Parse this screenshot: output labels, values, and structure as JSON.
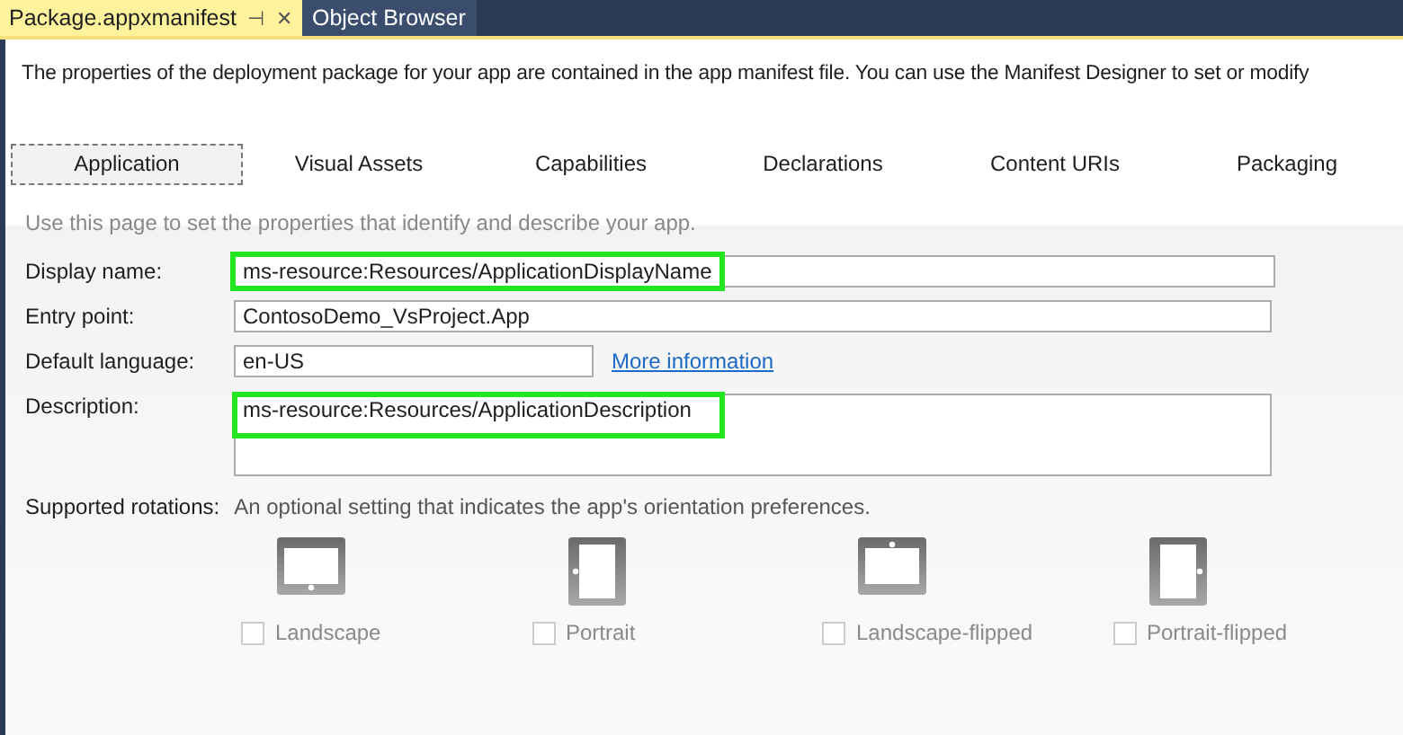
{
  "document_tabs": [
    {
      "label": "Package.appxmanifest",
      "selected": true,
      "pin": "⊣",
      "close": "✕"
    },
    {
      "label": "Object Browser",
      "selected": false
    }
  ],
  "intro": "The properties of the deployment package for your app are contained in the app manifest file. You can use the Manifest Designer to set or modify",
  "designer_tabs": [
    {
      "label": "Application",
      "selected": true
    },
    {
      "label": "Visual Assets",
      "selected": false
    },
    {
      "label": "Capabilities",
      "selected": false
    },
    {
      "label": "Declarations",
      "selected": false
    },
    {
      "label": "Content URIs",
      "selected": false
    },
    {
      "label": "Packaging",
      "selected": false
    }
  ],
  "hint": "Use this page to set the properties that identify and describe your app.",
  "fields": [
    {
      "kind": "text",
      "label": "Display name:",
      "value": "ms-resource:Resources/ApplicationDisplayName",
      "highlighted": true
    },
    {
      "kind": "text",
      "label": "Entry point:",
      "value": "ContosoDemo_VsProject.App",
      "highlighted": false
    },
    {
      "kind": "short",
      "label": "Default language:",
      "value": "en-US",
      "highlighted": false,
      "link": "More information"
    },
    {
      "kind": "multiline",
      "label": "Description:",
      "value": "ms-resource:Resources/ApplicationDescription",
      "highlighted": true
    }
  ],
  "rotations": {
    "label": "Supported rotations:",
    "description": "An optional setting that indicates the app's orientation preferences.",
    "options": [
      {
        "kind": "landscape",
        "label": "Landscape",
        "checked": false,
        "disabled": true
      },
      {
        "kind": "portrait",
        "label": "Portrait",
        "checked": false,
        "disabled": true
      },
      {
        "kind": "landscape-flipped",
        "label": "Landscape-flipped",
        "checked": false,
        "disabled": true
      },
      {
        "kind": "portrait-flipped",
        "label": "Portrait-flipped",
        "checked": false,
        "disabled": true
      }
    ]
  }
}
